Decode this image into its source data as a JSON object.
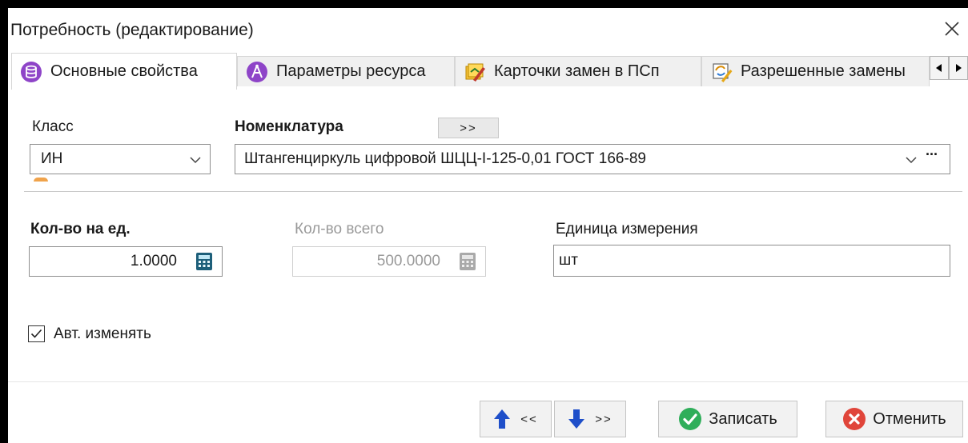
{
  "window": {
    "title": "Потребность (редактирование)"
  },
  "tabs": [
    {
      "label": "Основные свойства",
      "icon": "database-icon",
      "active": true
    },
    {
      "label": "Параметры ресурса",
      "icon": "compass-icon",
      "active": false
    },
    {
      "label": "Карточки замен в ПСп",
      "icon": "cards-edit-icon",
      "active": false
    },
    {
      "label": "Разрешенные замены",
      "icon": "replace-edit-icon",
      "active": false
    }
  ],
  "form": {
    "class": {
      "label": "Класс",
      "value": "ИН"
    },
    "nomenclature": {
      "label": "Номенклатура",
      "expand_label": ">>",
      "value": "Штангенциркуль цифровой ШЦЦ-I-125-0,01 ГОСТ 166-89",
      "more_label": "···"
    },
    "qty_per_unit": {
      "label": "Кол-во на ед.",
      "value": "1.0000"
    },
    "qty_total": {
      "label": "Кол-во всего",
      "value": "500.0000"
    },
    "unit": {
      "label": "Единица измерения",
      "value": "шт"
    },
    "auto_change": {
      "label": "Авт. изменять",
      "checked": true
    }
  },
  "buttons": {
    "prev_label": "<<",
    "next_label": ">>",
    "save_label": "Записать",
    "cancel_label": "Отменить"
  },
  "colors": {
    "accent_blue": "#1f4fc9",
    "save_green": "#2fae5a",
    "cancel_red": "#e0453a",
    "tab_purple": "#8e44c8"
  }
}
